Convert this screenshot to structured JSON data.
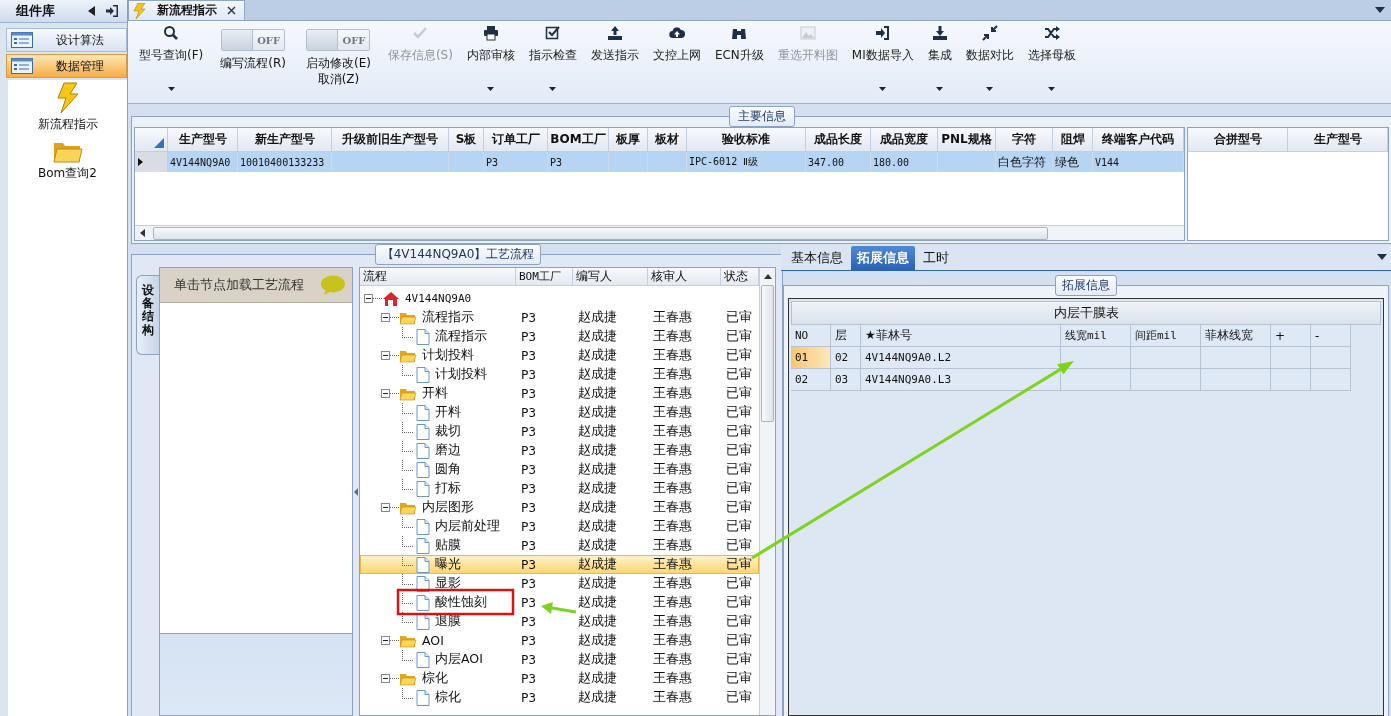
{
  "sidebar": {
    "title": "组件库",
    "items": [
      {
        "label": "设计算法",
        "selected": false
      },
      {
        "label": "数据管理",
        "selected": true
      }
    ],
    "shortcuts": [
      {
        "label": "新流程指示"
      },
      {
        "label": "Bom查询2"
      }
    ]
  },
  "tabs": [
    {
      "label": "新流程指示",
      "selected": true
    }
  ],
  "toolbar": [
    {
      "kind": "button",
      "label": "型号查询(F)",
      "dropdown": true,
      "disabled": false
    },
    {
      "kind": "toggle",
      "label": "编写流程(R)",
      "switch_text": "OFF",
      "on": false
    },
    {
      "kind": "toggle",
      "label": "启动修改(E)\n取消(Z)",
      "switch_text": "OFF",
      "on": false
    },
    {
      "kind": "button",
      "label": "保存信息(S)",
      "dropdown": false,
      "disabled": true
    },
    {
      "kind": "button",
      "label": "内部审核",
      "dropdown": true,
      "disabled": false
    },
    {
      "kind": "button",
      "label": "指示检查",
      "dropdown": true,
      "disabled": false
    },
    {
      "kind": "button",
      "label": "发送指示",
      "dropdown": false,
      "disabled": false
    },
    {
      "kind": "button",
      "label": "文控上网",
      "dropdown": false,
      "disabled": false
    },
    {
      "kind": "button",
      "label": "ECN升级",
      "dropdown": false,
      "disabled": false
    },
    {
      "kind": "button",
      "label": "重选开料图",
      "dropdown": false,
      "disabled": true
    },
    {
      "kind": "button",
      "label": "MI数据导入",
      "dropdown": true,
      "disabled": false
    },
    {
      "kind": "button",
      "label": "集成",
      "dropdown": true,
      "disabled": false
    },
    {
      "kind": "button",
      "label": "数据对比",
      "dropdown": true,
      "disabled": false
    },
    {
      "kind": "button",
      "label": "选择母板",
      "dropdown": true,
      "disabled": false
    }
  ],
  "main_info": {
    "title": "主要信息",
    "columns": [
      "生产型号",
      "新生产型号",
      "升级前旧生产型号",
      "S板",
      "订单工厂",
      "BOM工厂",
      "板厚",
      "板材",
      "验收标准",
      "成品长度",
      "成品宽度",
      "PNL规格",
      "字符",
      "阻焊",
      "终端客户代码"
    ],
    "rows": [
      {
        "selected": true,
        "cells": [
          "4V144NQ9A0",
          "10010400133233",
          null,
          null,
          "P3",
          "P3",
          null,
          null,
          "IPC-6012 Ⅱ级",
          "347.00",
          "180.00",
          null,
          "白色字符",
          "绿色",
          "V144"
        ]
      }
    ],
    "side_columns": [
      "合拼型号",
      "生产型号"
    ]
  },
  "process": {
    "title": "【4V144NQ9A0】工艺流程",
    "side_tab": "设备结构",
    "hint": "单击节点加载工艺流程",
    "columns": [
      "流程",
      "BOM工厂",
      "编写人",
      "核审人",
      "状态"
    ],
    "tree": [
      {
        "label": "4V144NQ9A0",
        "expanded": true,
        "selected": false,
        "children": [
          {
            "label": "流程指示",
            "bom": "P3",
            "writer": "赵成捷",
            "reviewer": "王春惠",
            "status": "已审",
            "expanded": true,
            "selected": false,
            "children": [
              {
                "label": "流程指示",
                "bom": "P3",
                "writer": "赵成捷",
                "reviewer": "王春惠",
                "status": "已审",
                "selected": false
              }
            ]
          },
          {
            "label": "计划投料",
            "bom": "P3",
            "writer": "赵成捷",
            "reviewer": "王春惠",
            "status": "已审",
            "expanded": true,
            "selected": false,
            "children": [
              {
                "label": "计划投料",
                "bom": "P3",
                "writer": "赵成捷",
                "reviewer": "王春惠",
                "status": "已审",
                "selected": false
              }
            ]
          },
          {
            "label": "开料",
            "bom": "P3",
            "writer": "赵成捷",
            "reviewer": "王春惠",
            "status": "已审",
            "expanded": true,
            "selected": false,
            "children": [
              {
                "label": "开料",
                "bom": "P3",
                "writer": "赵成捷",
                "reviewer": "王春惠",
                "status": "已审",
                "selected": false
              },
              {
                "label": "裁切",
                "bom": "P3",
                "writer": "赵成捷",
                "reviewer": "王春惠",
                "status": "已审",
                "selected": false
              },
              {
                "label": "磨边",
                "bom": "P3",
                "writer": "赵成捷",
                "reviewer": "王春惠",
                "status": "已审",
                "selected": false
              },
              {
                "label": "圆角",
                "bom": "P3",
                "writer": "赵成捷",
                "reviewer": "王春惠",
                "status": "已审",
                "selected": false
              },
              {
                "label": "打标",
                "bom": "P3",
                "writer": "赵成捷",
                "reviewer": "王春惠",
                "status": "已审",
                "selected": false
              }
            ]
          },
          {
            "label": "内层图形",
            "bom": "P3",
            "writer": "赵成捷",
            "reviewer": "王春惠",
            "status": "已审",
            "expanded": true,
            "selected": false,
            "children": [
              {
                "label": "内层前处理",
                "bom": "P3",
                "writer": "赵成捷",
                "reviewer": "王春惠",
                "status": "已审",
                "selected": false
              },
              {
                "label": "贴膜",
                "bom": "P3",
                "writer": "赵成捷",
                "reviewer": "王春惠",
                "status": "已审",
                "selected": false
              },
              {
                "label": "曝光",
                "bom": "P3",
                "writer": "赵成捷",
                "reviewer": "王春惠",
                "status": "已审",
                "selected": true
              },
              {
                "label": "显影",
                "bom": "P3",
                "writer": "赵成捷",
                "reviewer": "王春惠",
                "status": "已审",
                "selected": false
              },
              {
                "label": "酸性蚀刻",
                "bom": "P3",
                "writer": "赵成捷",
                "reviewer": "王春惠",
                "status": "已审",
                "selected": false
              },
              {
                "label": "退膜",
                "bom": "P3",
                "writer": "赵成捷",
                "reviewer": "王春惠",
                "status": "已审",
                "selected": false
              }
            ]
          },
          {
            "label": "AOI",
            "bom": "P3",
            "writer": "赵成捷",
            "reviewer": "王春惠",
            "status": "已审",
            "expanded": true,
            "selected": false,
            "children": [
              {
                "label": "内层AOI",
                "bom": "P3",
                "writer": "赵成捷",
                "reviewer": "王春惠",
                "status": "已审",
                "selected": false
              }
            ]
          },
          {
            "label": "棕化",
            "bom": "P3",
            "writer": "赵成捷",
            "reviewer": "王春惠",
            "status": "已审",
            "expanded": true,
            "selected": false,
            "children": [
              {
                "label": "棕化",
                "bom": "P3",
                "writer": "赵成捷",
                "reviewer": "王春惠",
                "status": "已审",
                "selected": false
              }
            ]
          }
        ]
      }
    ]
  },
  "ext": {
    "tabs": [
      {
        "label": "基本信息",
        "selected": false
      },
      {
        "label": "拓展信息",
        "selected": true
      },
      {
        "label": "工时",
        "selected": false
      }
    ],
    "title": "拓展信息",
    "table_title": "内层干膜表",
    "columns": [
      "NO",
      "层",
      "★菲林号",
      "线宽mil",
      "间距mil",
      "菲林线宽",
      "+",
      "-"
    ],
    "rows": [
      {
        "selected": true,
        "cells": [
          "01",
          "02",
          "4V144NQ9A0.L2"
        ]
      },
      {
        "selected": false,
        "cells": [
          "02",
          "03",
          "4V144NQ9A0.L3"
        ]
      }
    ]
  }
}
